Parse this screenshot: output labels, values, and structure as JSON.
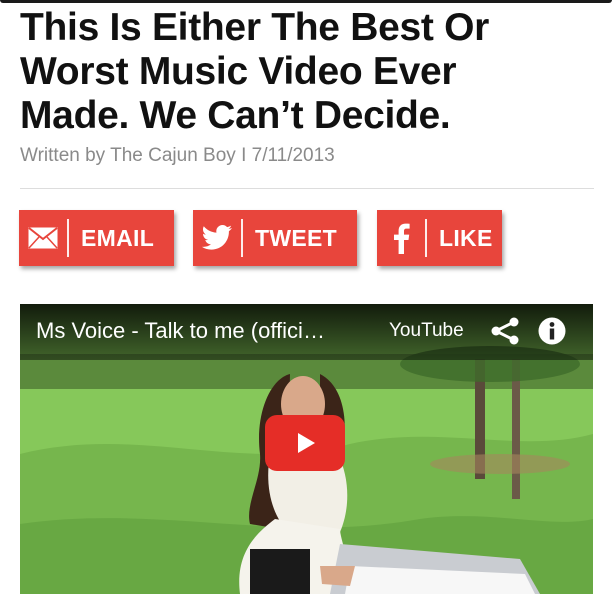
{
  "article": {
    "title_line1": "This Is Either The Best Or",
    "title_line2": "Worst Music Video Ever",
    "title_line3": "Made. We Can’t Decide.",
    "byline": "Written by The Cajun Boy I 7/11/2013"
  },
  "share": {
    "email_label": "EMAIL",
    "tweet_label": "TWEET",
    "like_label": "LIKE",
    "button_color": "#e8453c",
    "icons": [
      "envelope-icon",
      "twitter-bird-icon",
      "facebook-f-icon"
    ]
  },
  "video": {
    "title": "Ms Voice - Talk to me (offici…",
    "provider": "YouTube",
    "icons": [
      "share-icon",
      "info-icon",
      "play-icon"
    ],
    "play_color": "#e52d27"
  }
}
